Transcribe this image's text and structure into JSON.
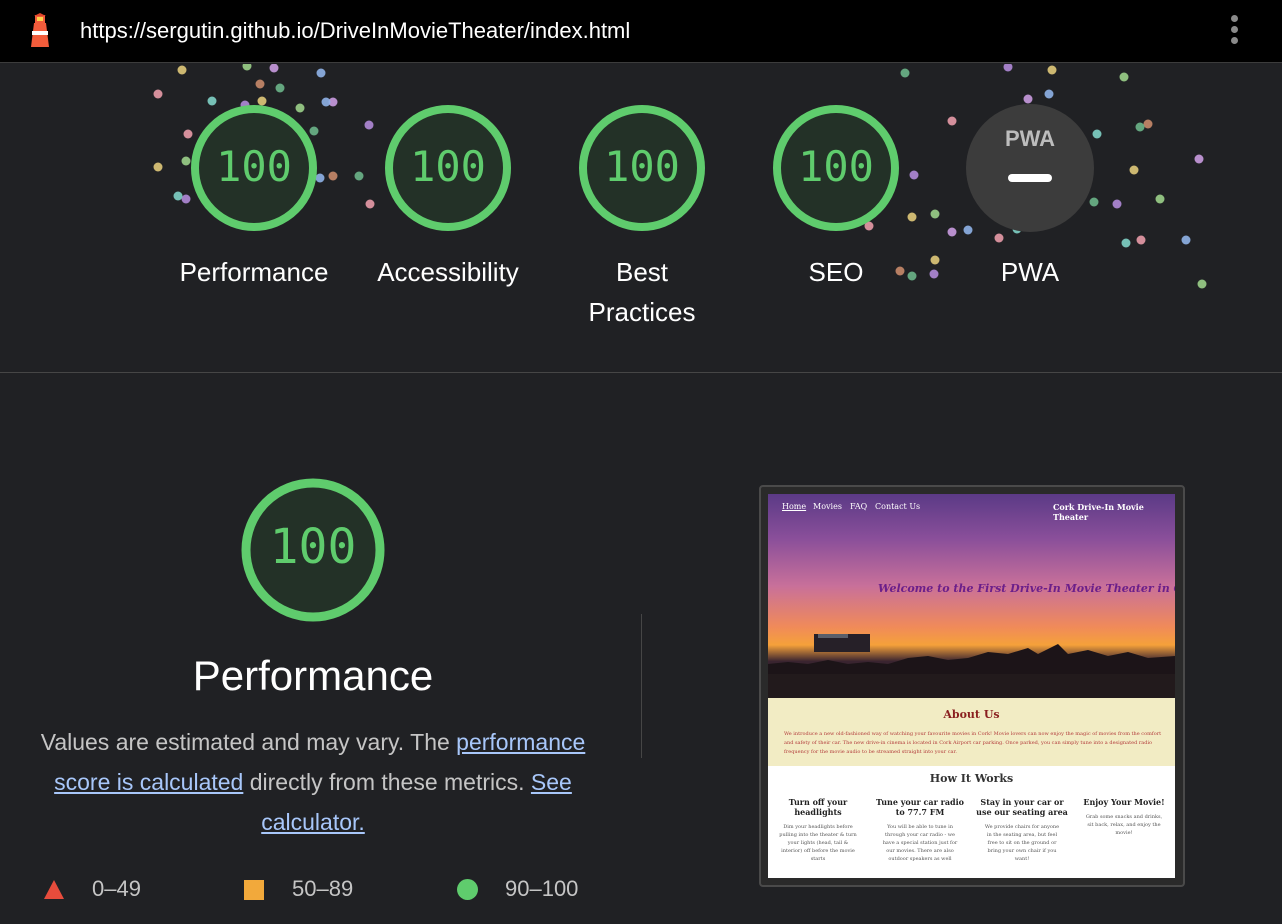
{
  "topbar": {
    "url": "https://sergutin.github.io/DriveInMovieTheater/index.html",
    "logo_icon": "lighthouse-icon",
    "menu_icon": "kebab-menu-icon"
  },
  "scores": [
    {
      "label": "Performance",
      "score": "100"
    },
    {
      "label": "Accessibility",
      "score": "100"
    },
    {
      "label": "Best Practices",
      "score": "100"
    },
    {
      "label": "SEO",
      "score": "100"
    },
    {
      "label": "PWA",
      "score": "—",
      "badge": "PWA"
    }
  ],
  "performance": {
    "score": "100",
    "title": "Performance",
    "desc_prefix": "Values are estimated and may vary. The ",
    "desc_link1": "performance score is calculated",
    "desc_middle": " directly from these metrics. ",
    "desc_link2": "See calculator."
  },
  "legend": [
    {
      "range": "0–49",
      "color": "#e74c3c",
      "shape": "triangle"
    },
    {
      "range": "50–89",
      "color": "#f2a93b",
      "shape": "square"
    },
    {
      "range": "90–100",
      "color": "#5fcc6d",
      "shape": "circle"
    }
  ],
  "screenshot": {
    "nav": [
      "Home",
      "Movies",
      "FAQ",
      "Contact Us"
    ],
    "site_title": "Cork Drive-In Movie Theater",
    "hero_title": "Welcome to the First Drive-In Movie Theater in Cork!",
    "about_heading": "About Us",
    "about_text": "We introduce a new old-fashioned way of watching your favourite movies in Cork! Movie lovers can now enjoy the magic of movies from the comfort and safety of their car. The new drive-in cinema is located in Cork Airport car parking. Once parked, you can simply tune into a designated radio frequency for the movie audio to be streamed straight into your car.",
    "how_heading": "How It Works",
    "columns": [
      {
        "title": "Turn off your headlights",
        "text": "Dim your headlights before pulling into the theater & turn your lights (head, tail & interior) off before the movie starts"
      },
      {
        "title": "Tune your car radio to 77.7 FM",
        "text": "You will be able to tune in through your car radio - we have a special station just for our movies. There are also outdoor speakers as well"
      },
      {
        "title": "Stay in your car or use our seating area",
        "text": "We provide chairs for anyone in the seating area, but feel free to sit on the ground or bring your own chair if you want!"
      },
      {
        "title": "Enjoy Your Movie!",
        "text": "Grab some snacks and drinks, sit back, relax, and enjoy the movie!"
      }
    ]
  },
  "colors": {
    "pass_green": "#5fcc6d",
    "background": "#202124",
    "link": "#a8c7fa"
  }
}
